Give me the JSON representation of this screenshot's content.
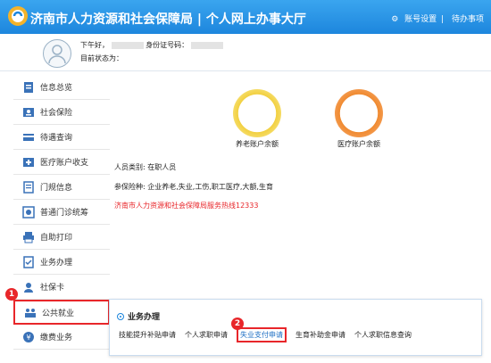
{
  "header": {
    "title": "济南市人力资源和社会保障局 | 个人网上办事大厅",
    "account_settings": "账号设置",
    "todo": "待办事项"
  },
  "user": {
    "greeting": "下午好，",
    "id_label": "身份证号码：",
    "status_label": "目前状态为："
  },
  "sidebar": {
    "items": [
      {
        "label": "信息总览",
        "icon": "info-overview-icon"
      },
      {
        "label": "社会保险",
        "icon": "social-insurance-icon"
      },
      {
        "label": "待遇查询",
        "icon": "benefit-query-icon"
      },
      {
        "label": "医疗账户收支",
        "icon": "medical-account-icon"
      },
      {
        "label": "门规信息",
        "icon": "clinic-info-icon"
      },
      {
        "label": "普通门诊统筹",
        "icon": "outpatient-icon"
      },
      {
        "label": "自助打印",
        "icon": "printer-icon"
      },
      {
        "label": "业务办理",
        "icon": "business-icon"
      },
      {
        "label": "社保卡",
        "icon": "id-card-icon"
      },
      {
        "label": "公共就业",
        "icon": "public-employment-icon"
      },
      {
        "label": "缴费业务",
        "icon": "payment-icon"
      }
    ]
  },
  "accounts": [
    {
      "label": "养老账户余额",
      "color": "#f2d040"
    },
    {
      "label": "医疗账户余额",
      "color": "#f08a30"
    }
  ],
  "info": {
    "person_type": "人员类别: 在职人员",
    "insured_types": "参保险种: 企业养老,失业,工伤,职工医疗,大额,生育",
    "hotline": "济南市人力资源和社会保障局服务热线12333"
  },
  "popup": {
    "title": "业务办理",
    "links": [
      "技能提升补贴申请",
      "个人求职申请",
      "失业支付申请",
      "生育补助金申请",
      "个人求职信息查询"
    ]
  },
  "badges": [
    "1",
    "2"
  ],
  "colors": {
    "header": "#1d86dd",
    "highlight": "#e8262a"
  }
}
